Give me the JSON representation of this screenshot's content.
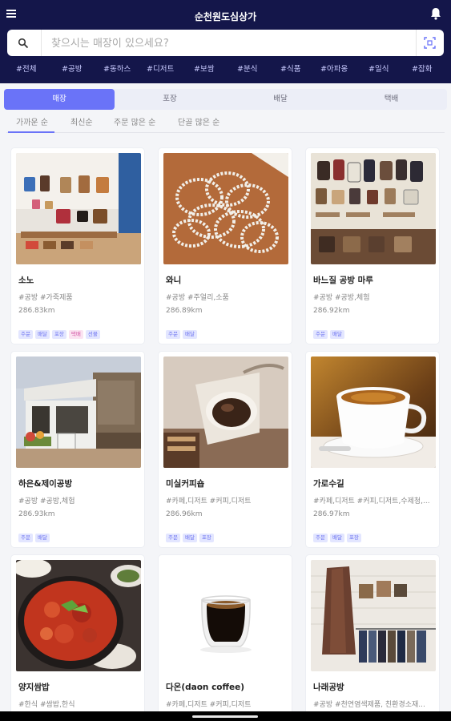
{
  "header": {
    "title": "순천원도심상가",
    "menu_icon": "hamburger-menu-icon",
    "bell_icon": "bell-icon",
    "accent": "#14164a"
  },
  "search": {
    "value": "",
    "placeholder": "찾으시는 매장이 있으세요?",
    "search_icon": "search-icon",
    "scan_icon": "qr-scan-icon"
  },
  "categories": [
    "#전체",
    "#공방",
    "#동하스",
    "#디저트",
    "#보쌈",
    "#분식",
    "#식품",
    "#아파옹",
    "#일식",
    "#잡화"
  ],
  "segments": {
    "items": [
      "매장",
      "포장",
      "배달",
      "택배"
    ],
    "active_index": 0,
    "accent": "#6a73f8"
  },
  "sort": {
    "items": [
      "가까운 순",
      "최신순",
      "주문 많은 순",
      "단골 많은 순"
    ],
    "active_index": 0
  },
  "stores": [
    {
      "name": "소노",
      "tags": "#공방 #가죽제품",
      "distance": "286.83km",
      "image": "leather-goods-shop",
      "badges": [
        "주문",
        "배달",
        "포장",
        "택배",
        "선물"
      ]
    },
    {
      "name": "와니",
      "tags": "#공방 #주얼리,소품",
      "distance": "286.89km",
      "image": "bead-bracelets",
      "badges": [
        "주문",
        "배달"
      ]
    },
    {
      "name": "바느질 공방 마루",
      "tags": "#공방 #공방,체험",
      "distance": "286.92km",
      "image": "handmade-bags-wall",
      "badges": [
        "주문",
        "배달"
      ]
    },
    {
      "name": "하은&제이공방",
      "tags": "#공방 #공방,체험",
      "distance": "286.93km",
      "image": "workshop-storefront",
      "badges": [
        "주문",
        "배달"
      ]
    },
    {
      "name": "미실커피숍",
      "tags": "#카페,디저트 #커피,디저트",
      "distance": "286.96km",
      "image": "pour-over-coffee",
      "badges": [
        "주문",
        "배달",
        "포장"
      ]
    },
    {
      "name": "가로수길",
      "tags": "#카페,디저트 #커피,디저트,수제청,...",
      "distance": "286.97km",
      "image": "coffee-cup",
      "badges": [
        "주문",
        "배달",
        "포장"
      ]
    },
    {
      "name": "양지쌈밥",
      "tags": "#한식 #쌈밥,한식",
      "distance": "",
      "image": "korean-stew-pot",
      "badges": []
    },
    {
      "name": "다온(daon coffee)",
      "tags": "#카페,디저트 #커피,디저트",
      "distance": "",
      "image": "espresso-glass",
      "badges": []
    },
    {
      "name": "나래공방",
      "tags": "#공방 #천연염색제품, 친환경소재...",
      "distance": "",
      "image": "clothing-rack",
      "badges": []
    }
  ]
}
